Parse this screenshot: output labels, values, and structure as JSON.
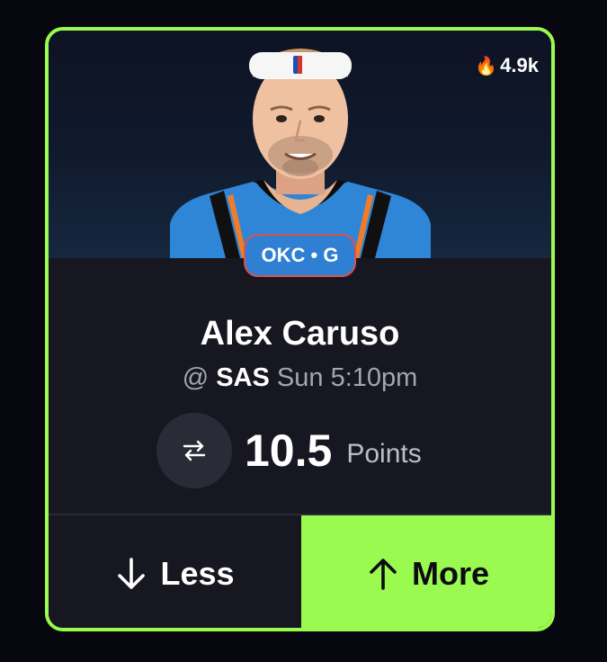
{
  "card": {
    "popularity": {
      "icon": "flame-icon",
      "value": "4.9k"
    },
    "team_position": "OKC • G",
    "player_name": "Alex Caruso",
    "matchup": {
      "prefix": "@",
      "opponent": "SAS",
      "time": "Sun 5:10pm"
    },
    "line": {
      "value": "10.5",
      "stat": "Points",
      "swap_icon": "swap-arrows-icon"
    },
    "less_button": {
      "label": "Less",
      "icon": "arrow-down-icon"
    },
    "more_button": {
      "label": "More",
      "icon": "arrow-up-icon"
    }
  },
  "colors": {
    "accent": "#9bfa50",
    "card_bg": "#171722",
    "badge_bg": "#2f7fd3",
    "badge_border": "#d9534f"
  }
}
